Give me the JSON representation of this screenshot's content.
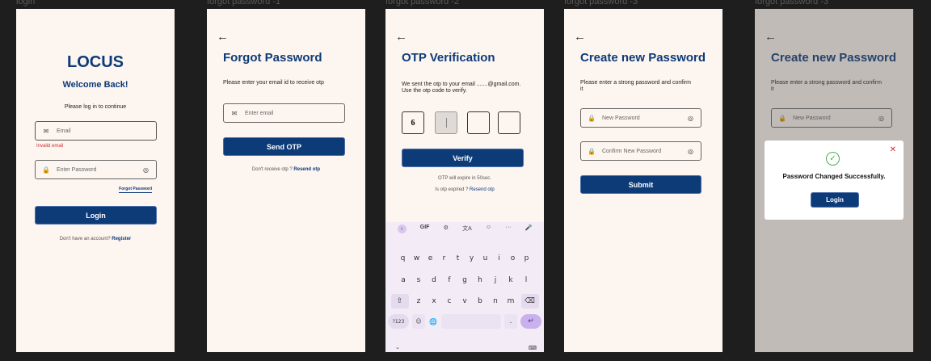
{
  "frame_labels": [
    "login",
    "forgot password -1",
    "forgot password -2",
    "forgot password -3",
    "forgot password -3"
  ],
  "login": {
    "app_name": "LOCUS",
    "welcome": "Welcome Back!",
    "subtitle": "Please log in to continue",
    "email_placeholder": "Email",
    "email_error": "Invalid email",
    "password_placeholder": "Enter Password",
    "forgot_link": "Forgot Password",
    "login_button": "Login",
    "register_prompt": "Don't have an account? ",
    "register_link": "Register"
  },
  "forgot1": {
    "title": "Forgot Password",
    "description": "Please enter your email id to receive otp",
    "email_placeholder": "Enter email",
    "send_button": "Send OTP",
    "resend_prompt": "Don't receive otp ? ",
    "resend_link": "Resend otp"
  },
  "forgot2": {
    "title": "OTP Verification",
    "description": "We sent the otp to your email .......@gmail.com. Use the otp code to verify.",
    "otp_digits": [
      "6",
      "",
      "",
      ""
    ],
    "verify_button": "Verify",
    "expire_text": "OTP will expire in 50sec.",
    "expired_prompt": "Is otp expired ? ",
    "resend_link": "Resend otp",
    "keyboard": {
      "toolbar": [
        "‹",
        "GIF",
        "⚙",
        "文A",
        "☺",
        "···",
        "🎤"
      ],
      "row1": [
        "q",
        "w",
        "e",
        "r",
        "t",
        "y",
        "u",
        "i",
        "o",
        "p"
      ],
      "row2": [
        "a",
        "s",
        "d",
        "f",
        "g",
        "h",
        "j",
        "k",
        "l"
      ],
      "row3": [
        "⇧",
        "z",
        "x",
        "c",
        "v",
        "b",
        "n",
        "m",
        "⌫"
      ],
      "row4": [
        "?123",
        "☺",
        "🌐",
        "",
        ".",
        "↵"
      ]
    }
  },
  "forgot3": {
    "title": "Create new Password",
    "description": "Please enter a strong password and confirm it",
    "new_password_placeholder": "New Password",
    "confirm_password_placeholder": "Confirm New Password",
    "submit_button": "Submit"
  },
  "forgot3b": {
    "title": "Create new Password",
    "description": "Please enter a strong password and confirm it",
    "new_password_placeholder": "New Password",
    "success_message": "Password Changed Successfully.",
    "login_button": "Login"
  },
  "colors": {
    "primary": "#0d3b78",
    "background": "#fdf5f0",
    "error": "#d32f2f",
    "success": "#4caf50"
  }
}
